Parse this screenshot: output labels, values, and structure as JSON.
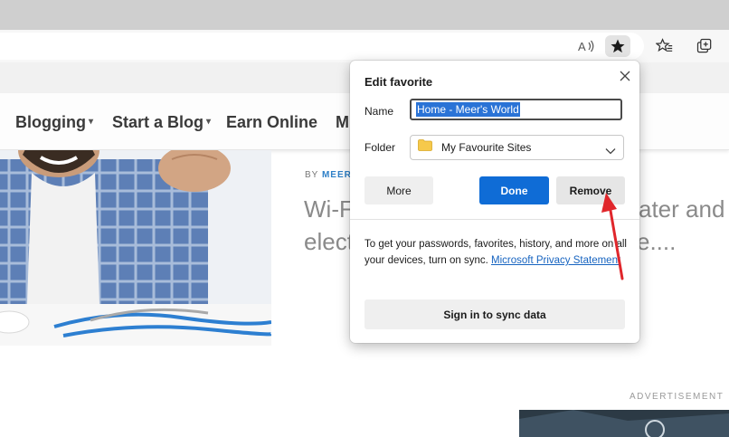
{
  "browser": {
    "icons": [
      "read-aloud-icon",
      "favorite-star-icon",
      "favorites-list-icon",
      "collections-icon"
    ],
    "accent": "#0f6cd6"
  },
  "site": {
    "nav": [
      {
        "label": "Blogging",
        "has_dropdown": true
      },
      {
        "label": "Start a Blog",
        "has_dropdown": true
      },
      {
        "label": "Earn Online",
        "has_dropdown": false
      },
      {
        "label": "M",
        "has_dropdown": false
      }
    ],
    "byline_prefix": "BY",
    "byline_author": "MEER'",
    "title_line1": "Wi-F",
    "title_line2": "elect",
    "title_tail1": "ater and",
    "title_tail2": "e....",
    "ad_label": "ADVERTISEMENT"
  },
  "popup": {
    "title": "Edit favorite",
    "name_label": "Name",
    "name_value": "Home - Meer's World",
    "folder_label": "Folder",
    "folder_value": "My Favourite Sites",
    "more_label": "More",
    "done_label": "Done",
    "remove_label": "Remove",
    "sync_text": "To get your passwords, favorites, history, and more on all your devices, turn on sync.",
    "privacy_link": "Microsoft Privacy Statement",
    "signin_label": "Sign in to sync data"
  }
}
